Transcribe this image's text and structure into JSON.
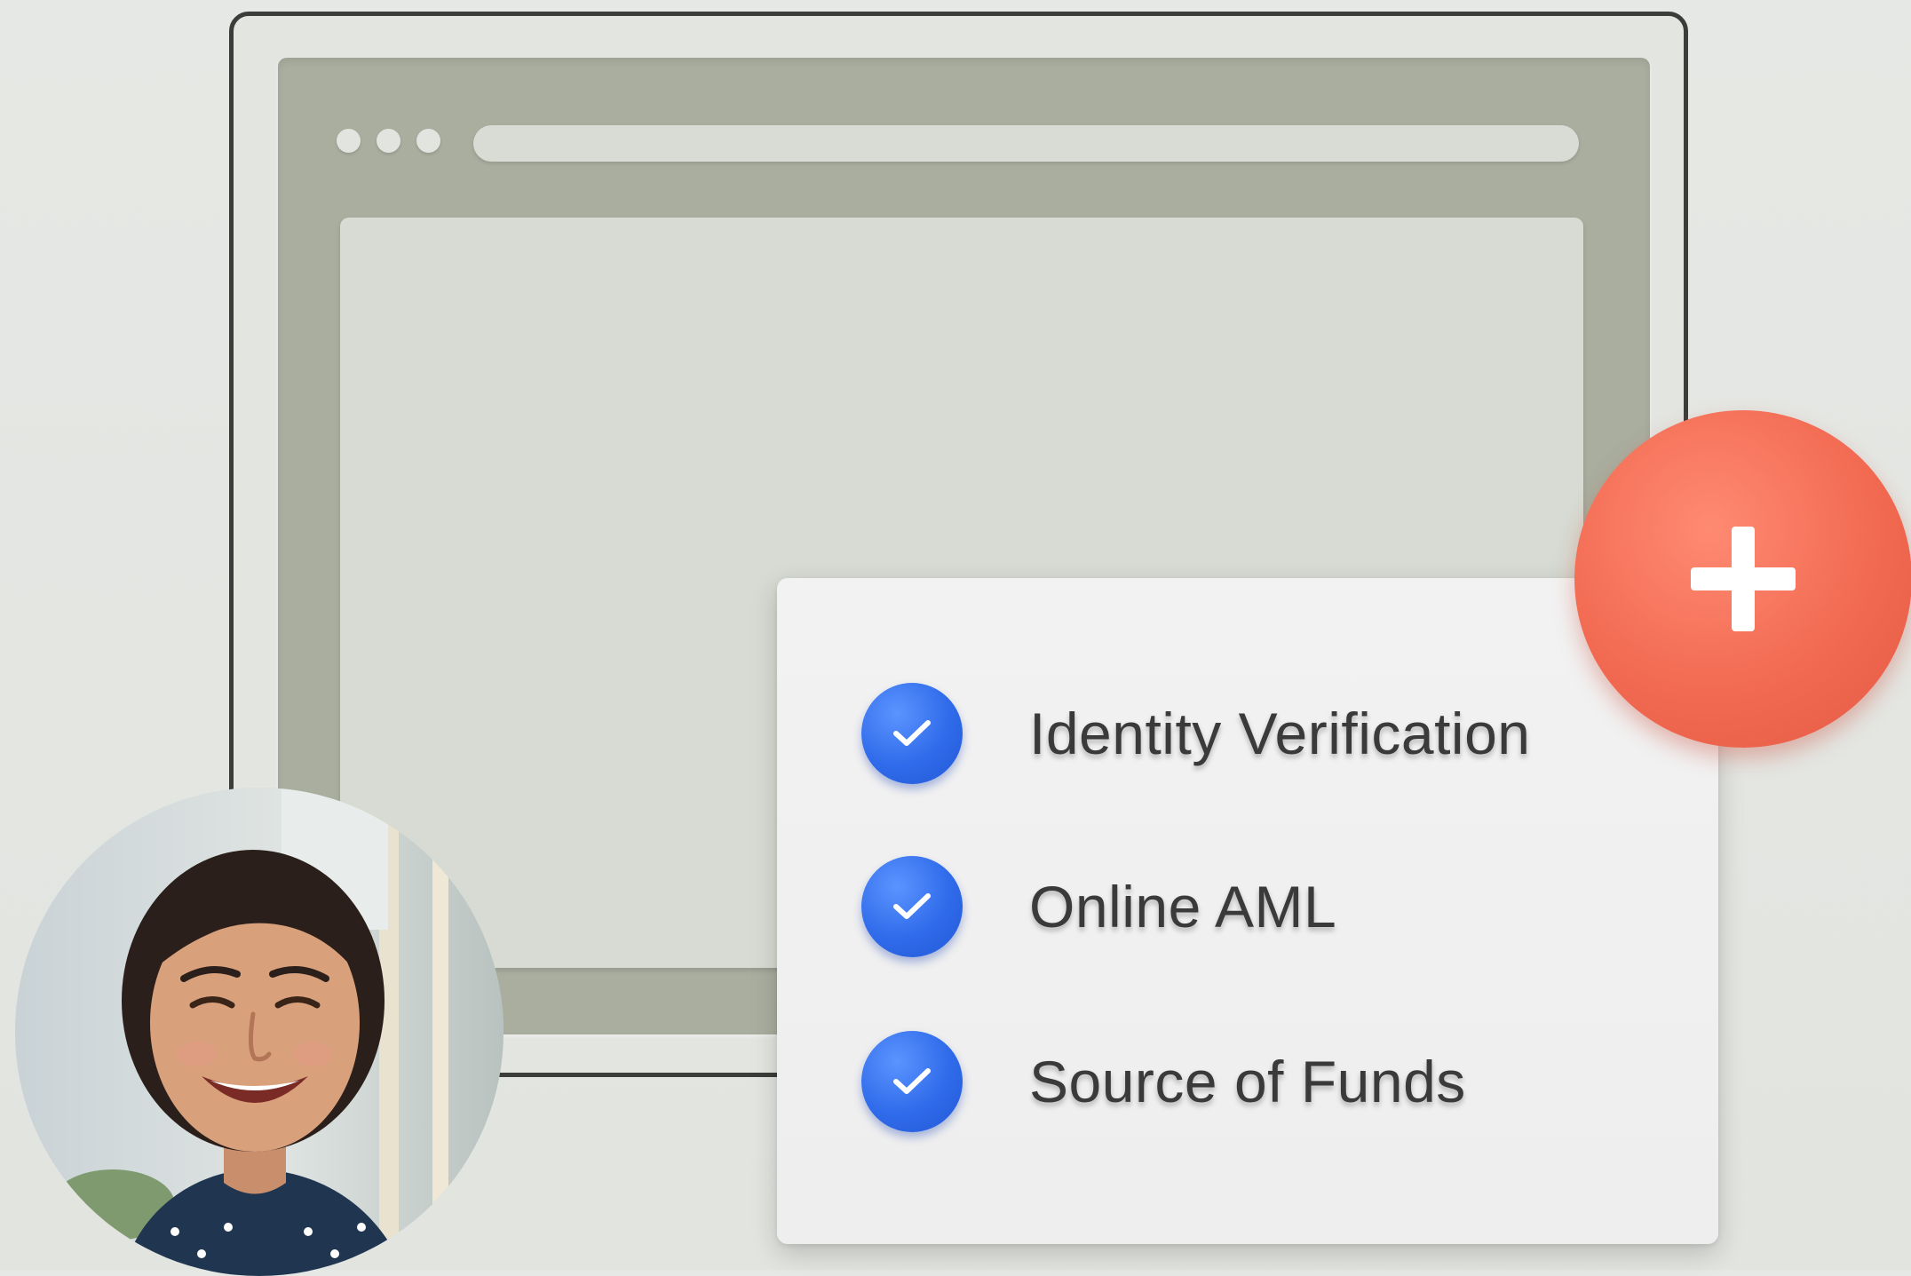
{
  "browser": {
    "window_dots": [
      "dot",
      "dot",
      "dot"
    ]
  },
  "checklist": {
    "items": [
      {
        "label": "Identity Verification",
        "icon": "checkmark-icon",
        "checked": true
      },
      {
        "label": "Online AML",
        "icon": "checkmark-icon",
        "checked": true
      },
      {
        "label": "Source of Funds",
        "icon": "checkmark-icon",
        "checked": true
      }
    ]
  },
  "add_button": {
    "icon": "plus-icon"
  },
  "avatar": {
    "icon": "user-photo"
  },
  "colors": {
    "check_blue": "#2f6bea",
    "plus_coral": "#f26a52",
    "browser_gray": "#a9ae9f",
    "card_bg": "#f0f0f0"
  }
}
